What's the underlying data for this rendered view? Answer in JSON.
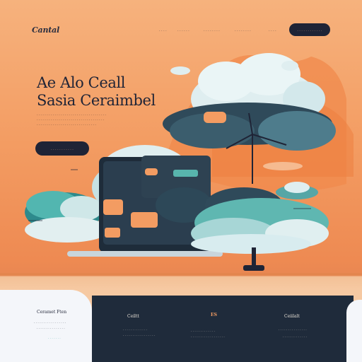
{
  "nav": {
    "logo": "Cantal",
    "links": [
      "- - - -",
      "- - - - - -",
      "- - - - - - - -",
      "- - - - - - - -",
      "- - - -"
    ],
    "cta_label": "- - - - - - - - - - - -"
  },
  "hero": {
    "title_line1": "Ae Alo Ceall",
    "title_line2": "Sasia Ceraimbel",
    "desc_lines": [
      "- - - - - - - - - - - - - - - - - - - - - - - - - - - - - - - - - - -",
      "- - - - - - - - - - - - - - - - - - - - - - - - - - - - - - - - - -",
      "- - - - - - - - - - - - - - - - - - - - - - - - - - - - - -"
    ],
    "cta_label": "- - - - - - - - - - -"
  },
  "features": [
    {
      "title": "Ceramet Ften",
      "lines": [
        "- - - - - - - - - - - - - - - - -",
        "- - - - - - - - - - - - - - -",
        "- - - - - - -"
      ]
    },
    {
      "title": "Ceiltt",
      "lines": [
        "- - - - - - - - - - - - -",
        "- - - - - - - - - - - - - - - - -"
      ]
    },
    {
      "title": "ES",
      "lines": [
        "- - - - - - - - - - - - -",
        "- - - - - - - - - - - - - - - - - -"
      ]
    },
    {
      "title": "Ceiilalt",
      "lines": [
        "- - - - - - - - - - - - - - -",
        "- - - - - - - - - - - - -"
      ]
    }
  ],
  "colors": {
    "accent": "#f39c62",
    "dark": "#1f2436",
    "teal": "#3fa8a4",
    "cloud": "#d8ecef"
  }
}
